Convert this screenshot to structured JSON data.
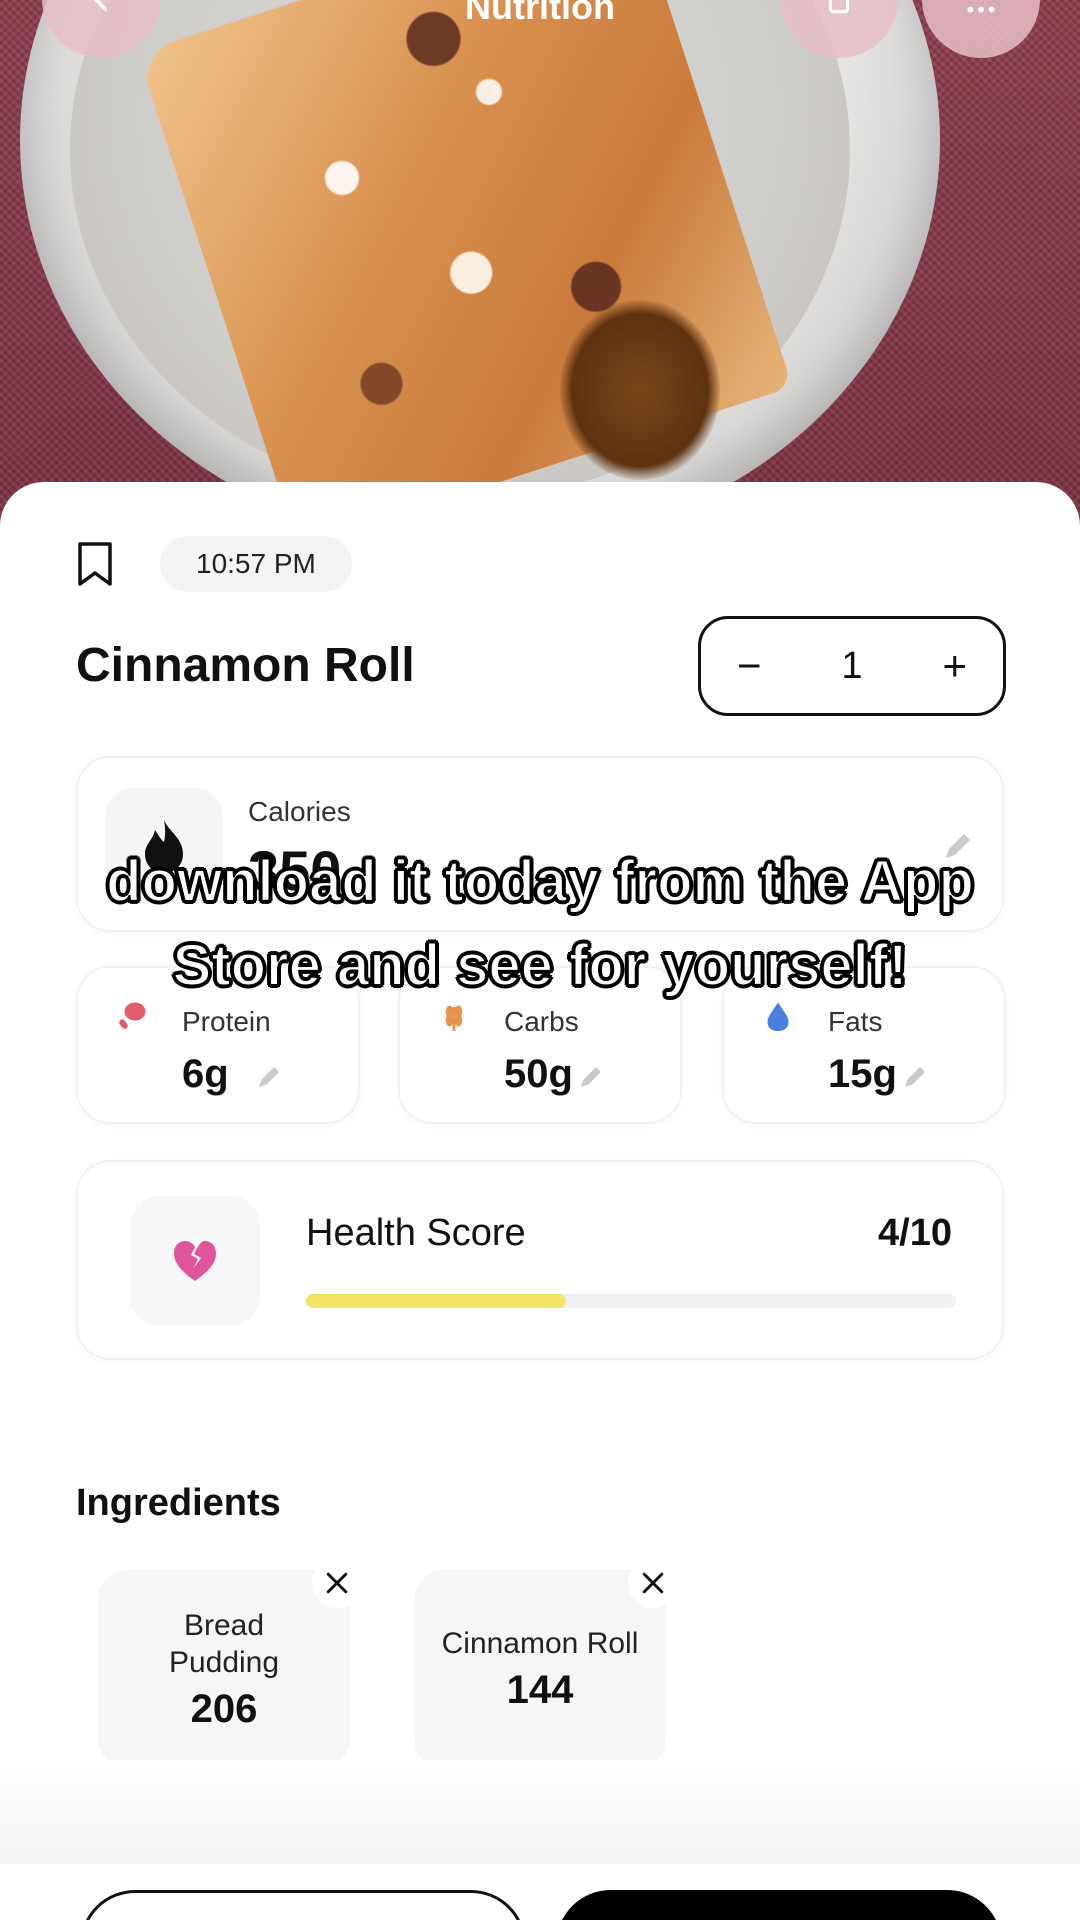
{
  "header": {
    "title": "Nutrition",
    "back_icon": "chevron-left-icon",
    "share_icon": "share-icon",
    "more_icon": "ellipsis-icon"
  },
  "meta": {
    "bookmark_icon": "bookmark-icon",
    "time": "10:57 PM"
  },
  "food": {
    "name": "Cinnamon Roll",
    "quantity": "1",
    "decrement_label": "−",
    "increment_label": "+"
  },
  "calories": {
    "label": "Calories",
    "value": "350",
    "icon": "flame-icon"
  },
  "macros": {
    "protein": {
      "label": "Protein",
      "value": "6g",
      "icon": "drumstick-icon",
      "color": "#e35d6a"
    },
    "carbs": {
      "label": "Carbs",
      "value": "50g",
      "icon": "wheat-icon",
      "color": "#e8934a"
    },
    "fats": {
      "label": "Fats",
      "value": "15g",
      "icon": "droplet-icon",
      "color": "#4a7fe0"
    }
  },
  "health": {
    "label": "Health Score",
    "score": "4/10",
    "level": 0.4,
    "icon": "broken-heart-icon",
    "icon_color": "#e0559a",
    "bar_color": "#f3e468"
  },
  "ingredients": {
    "title": "Ingredients",
    "items": [
      {
        "name": "Bread Pudding",
        "value": "206"
      },
      {
        "name": "Cinnamon Roll",
        "value": "144"
      }
    ]
  },
  "caption": {
    "text": "download it today from the App Store and see for yourself!"
  }
}
